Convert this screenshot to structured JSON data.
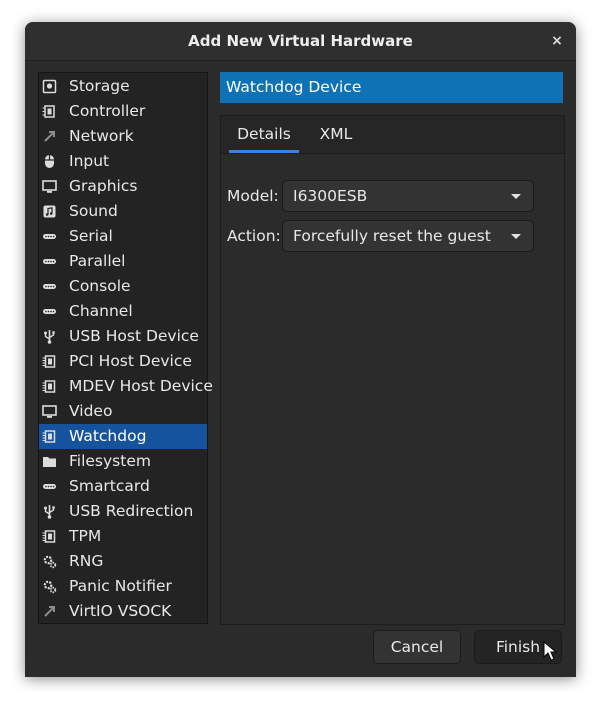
{
  "window": {
    "title": "Add New Virtual Hardware",
    "close_glyph": "×"
  },
  "sidebar": {
    "selected_index": 14,
    "items": [
      {
        "label": "Storage",
        "icon": "storage-icon"
      },
      {
        "label": "Controller",
        "icon": "controller-icon"
      },
      {
        "label": "Network",
        "icon": "network-icon"
      },
      {
        "label": "Input",
        "icon": "mouse-icon"
      },
      {
        "label": "Graphics",
        "icon": "monitor-icon"
      },
      {
        "label": "Sound",
        "icon": "sound-icon"
      },
      {
        "label": "Serial",
        "icon": "port-icon"
      },
      {
        "label": "Parallel",
        "icon": "port-icon"
      },
      {
        "label": "Console",
        "icon": "port-icon"
      },
      {
        "label": "Channel",
        "icon": "port-icon"
      },
      {
        "label": "USB Host Device",
        "icon": "usb-icon"
      },
      {
        "label": "PCI Host Device",
        "icon": "chip-icon"
      },
      {
        "label": "MDEV Host Device",
        "icon": "chip-icon"
      },
      {
        "label": "Video",
        "icon": "monitor-icon"
      },
      {
        "label": "Watchdog",
        "icon": "chip-icon"
      },
      {
        "label": "Filesystem",
        "icon": "folder-icon"
      },
      {
        "label": "Smartcard",
        "icon": "port-icon"
      },
      {
        "label": "USB Redirection",
        "icon": "usb-icon"
      },
      {
        "label": "TPM",
        "icon": "chip-icon"
      },
      {
        "label": "RNG",
        "icon": "gear-icon"
      },
      {
        "label": "Panic Notifier",
        "icon": "gear-icon"
      },
      {
        "label": "VirtIO VSOCK",
        "icon": "network-icon"
      }
    ]
  },
  "section": {
    "title": "Watchdog Device"
  },
  "tabs": [
    {
      "label": "Details",
      "active": true
    },
    {
      "label": "XML",
      "active": false
    }
  ],
  "form": {
    "model_label": "Model:",
    "model_value": "I6300ESB",
    "action_label": "Action:",
    "action_value": "Forcefully reset the guest"
  },
  "buttons": {
    "cancel": "Cancel",
    "finish": "Finish"
  },
  "colors": {
    "selection": "#15539e",
    "header": "#0f72b5",
    "tab_indicator": "#3584e4"
  }
}
